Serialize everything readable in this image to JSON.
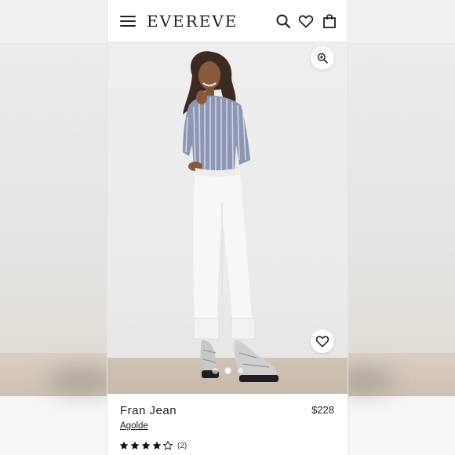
{
  "header": {
    "logo_text": "EVEREVE",
    "icons": [
      "menu-icon",
      "search-icon",
      "heart-icon",
      "shopping-bag-icon"
    ]
  },
  "gallery": {
    "slide_count": 3,
    "active_slide": 1
  },
  "product": {
    "name": "Fran Jean",
    "price": "$228",
    "brand": "Agolde",
    "rating": 4,
    "rating_max": 5,
    "review_count": "(2)"
  },
  "colors": {
    "text": "#222222",
    "backdrop": "#ececec",
    "floor": "#cbbcad"
  }
}
